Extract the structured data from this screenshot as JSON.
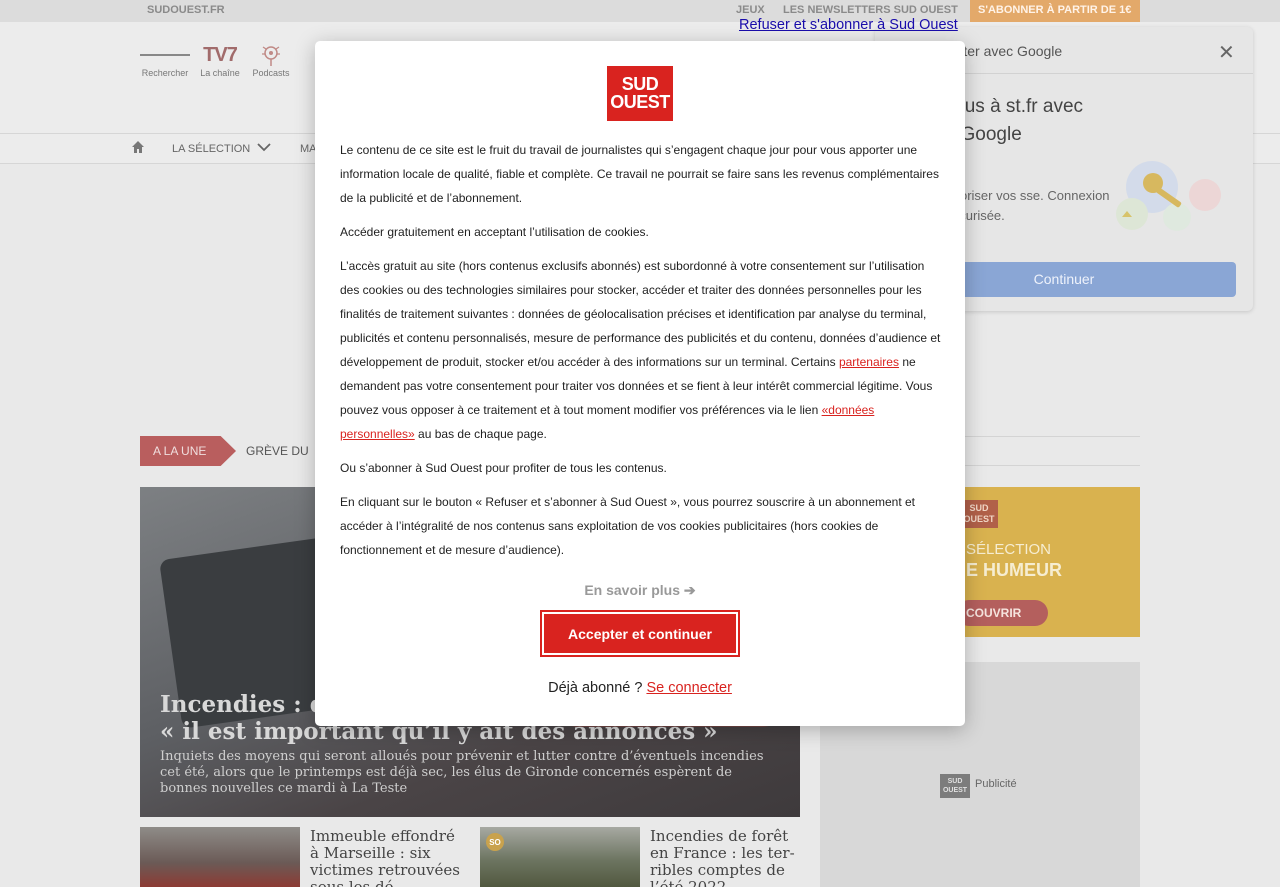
{
  "topbar": {
    "site": "SUDOUEST.FR",
    "jeux": "JEUX",
    "newsletters": "LES NEWSLETTERS SUD OUEST",
    "subscribe": "S'ABONNER À PARTIR DE 1€"
  },
  "header": {
    "search_label": "Rechercher",
    "tv7_logo": "TV7",
    "tv7_label": "La chaîne",
    "podcasts_label": "Podcasts"
  },
  "nav": {
    "selection": "LA SÉLECTION",
    "partial": "MA"
  },
  "ticker": {
    "une": "A LA UNE",
    "item": "GRÈVE DU"
  },
  "hero": {
    "title_line1": "Incendies : d",
    "title_line2": "« il est important qu’il y ait des annonces »",
    "lead": "Inquiets des moyens qui seront alloués pour prévenir et lutter contre d’éventuels incendies cet été, alors que le printemps est déjà sec, les élus de Gironde concernés espèrent de bonnes nouvelles ce mardi à La Teste"
  },
  "cards": [
    {
      "title": "Immeuble effondré à Marseille : six victimes retrouvées sous les dé..."
    },
    {
      "badge": "SO",
      "title": "Incendies de forêt en France : les ter-ribles comptes de l’été 2022"
    }
  ],
  "promo": {
    "logo": "SUD OUEST",
    "line1": "SÉLECTION",
    "line2": "E HUMEUR",
    "button": "COUVRIR"
  },
  "ad": {
    "logo": "SUD OUEST",
    "label": "Publicité"
  },
  "google_prompt": {
    "title": "nnecter avec Google",
    "heading": "tez-vous à st.fr avec votre Google",
    "text": "de mémoriser vos sse. Connexion de et sécurisée.",
    "button": "Continuer"
  },
  "refuse_link": "Refuser et s'abonner à Sud Ouest",
  "modal": {
    "logo": "SUD OUEST",
    "p1": "Le contenu de ce site est le fruit du travail de journalistes qui s’engagent chaque jour pour vous apporter une information locale de qualité, fiable et complète. Ce travail ne pourrait se faire sans les revenus complémentaires de la publicité et de l’abonnement.",
    "p2": "Accéder gratuitement en acceptant l’utilisation de cookies.",
    "p3_a": "L’accès gratuit au site (hors contenus exclusifs abonnés) est subordonné à votre consentement sur l’utilisation des cookies ou des technologies similaires pour stocker, accéder et traiter des données personnelles pour les finalités de traitement suivantes : données de géolocalisation précises et identification par analyse du terminal, publicités et contenu personnalisés, mesure de performance des publicités et du contenu, données d’audience et développement de produit, stocker et/ou accéder à des informations sur un terminal. Certains ",
    "p3_link1": "partenaires",
    "p3_b": " ne demandent pas votre consentement pour traiter vos données et se fient à leur intérêt commercial légitime. Vous pouvez vous opposer à ce traitement et à tout moment modifier vos préférences via le lien ",
    "p3_link2": "«données personnelles»",
    "p3_c": " au bas de chaque page.",
    "p4": "Ou s’abonner à Sud Ouest pour profiter de tous les contenus.",
    "p5": "En cliquant sur le bouton « Refuser et s’abonner à Sud Ouest », vous pourrez souscrire à un abonnement et accéder à l’intégralité de nos contenus sans exploitation de vos cookies publicitaires (hors cookies de fonctionnement et de mesure d’audience).",
    "more": "En savoir plus ➔",
    "accept": "Accepter et continuer",
    "already": "Déjà abonné ?",
    "login": "Se connecter"
  },
  "colors": {
    "brand_red": "#d9231f",
    "google_button": "#8aa6d5"
  }
}
